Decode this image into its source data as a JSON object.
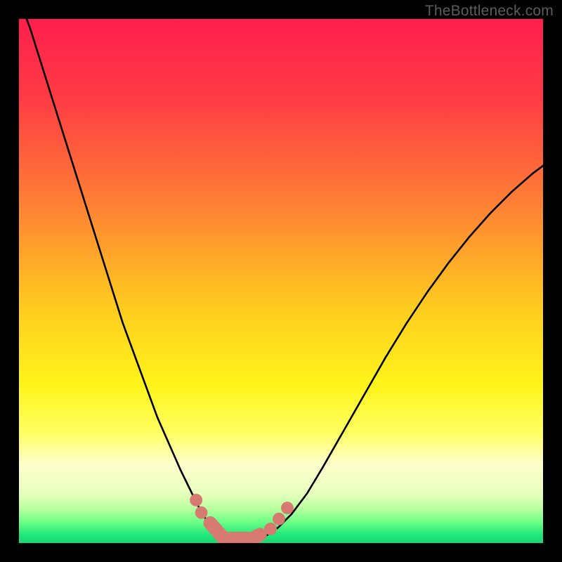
{
  "watermark": {
    "text": "TheBottleneck.com"
  },
  "colors": {
    "frame": "#000000",
    "curve_stroke": "#000000",
    "marker_fill": "#d67a72",
    "marker_stroke": "#d67a72"
  },
  "chart_data": {
    "type": "line",
    "title": "",
    "xlabel": "",
    "ylabel": "",
    "xlim": [
      0,
      100
    ],
    "ylim": [
      0,
      100
    ],
    "gradient_stops": [
      {
        "offset": 0.0,
        "color": "#ff1f4d"
      },
      {
        "offset": 0.15,
        "color": "#ff3b44"
      },
      {
        "offset": 0.35,
        "color": "#ff7f35"
      },
      {
        "offset": 0.55,
        "color": "#ffcc1f"
      },
      {
        "offset": 0.7,
        "color": "#fff51a"
      },
      {
        "offset": 0.79,
        "color": "#ffff63"
      },
      {
        "offset": 0.85,
        "color": "#fdffcc"
      },
      {
        "offset": 0.905,
        "color": "#e7ffbe"
      },
      {
        "offset": 0.935,
        "color": "#b8ff9f"
      },
      {
        "offset": 0.96,
        "color": "#6cff86"
      },
      {
        "offset": 0.985,
        "color": "#1fe77a"
      },
      {
        "offset": 1.0,
        "color": "#18d873"
      }
    ],
    "series": [
      {
        "name": "left-branch",
        "x": [
          0.0,
          2.2,
          4.4,
          6.6,
          8.8,
          11.0,
          13.2,
          15.4,
          17.6,
          19.8,
          22.0,
          24.2,
          26.4,
          28.6,
          30.8,
          33.0,
          34.5,
          36.0,
          37.5,
          39.0
        ],
        "y": [
          104.0,
          98.0,
          91.0,
          84.0,
          77.0,
          70.0,
          63.0,
          56.0,
          49.0,
          42.0,
          36.0,
          30.0,
          24.0,
          19.0,
          14.0,
          9.5,
          6.5,
          4.0,
          2.0,
          0.8
        ]
      },
      {
        "name": "trough",
        "x": [
          39.0,
          40.0,
          41.0,
          42.0,
          43.0,
          44.0,
          45.0,
          46.0,
          47.0
        ],
        "y": [
          0.8,
          0.35,
          0.18,
          0.12,
          0.12,
          0.18,
          0.35,
          0.7,
          1.3
        ]
      },
      {
        "name": "right-branch",
        "x": [
          47.0,
          49.5,
          52.0,
          55.0,
          58.0,
          62.0,
          66.0,
          70.0,
          74.0,
          78.0,
          82.0,
          86.0,
          90.0,
          94.0,
          98.0,
          100.0
        ],
        "y": [
          1.3,
          3.0,
          5.5,
          9.5,
          14.5,
          21.5,
          28.5,
          35.5,
          42.0,
          48.0,
          53.5,
          58.5,
          63.0,
          67.0,
          70.5,
          72.0
        ]
      }
    ],
    "markers": [
      {
        "kind": "circle",
        "x": 33.8,
        "y": 8.2,
        "r": 1.2
      },
      {
        "kind": "circle",
        "x": 34.8,
        "y": 5.8,
        "r": 1.2
      },
      {
        "kind": "pill",
        "x1": 36.5,
        "y1": 3.8,
        "x2": 39.0,
        "y2": 0.95,
        "w": 2.6
      },
      {
        "kind": "pill",
        "x1": 39.3,
        "y1": 0.85,
        "x2": 44.2,
        "y2": 0.85,
        "w": 2.6
      },
      {
        "kind": "pill",
        "x1": 44.6,
        "y1": 0.9,
        "x2": 46.0,
        "y2": 1.6,
        "w": 2.6
      },
      {
        "kind": "circle",
        "x": 48.0,
        "y": 2.7,
        "r": 1.2
      },
      {
        "kind": "circle",
        "x": 49.6,
        "y": 4.6,
        "r": 1.2
      },
      {
        "kind": "circle",
        "x": 51.2,
        "y": 6.7,
        "r": 1.2
      }
    ]
  }
}
